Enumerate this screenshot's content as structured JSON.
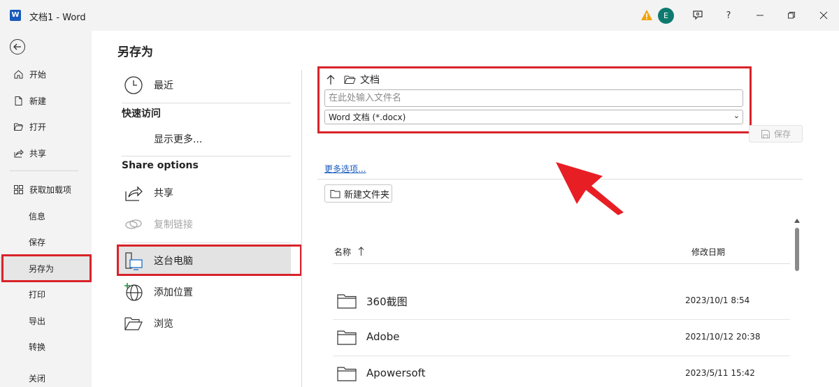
{
  "window": {
    "title": "文档1  -  Word",
    "avatar_initial": "E",
    "help_label": "?"
  },
  "leftnav": {
    "items": [
      {
        "label": "开始",
        "icon": "home-icon"
      },
      {
        "label": "新建",
        "icon": "new-doc-icon"
      },
      {
        "label": "打开",
        "icon": "open-folder-icon"
      },
      {
        "label": "共享",
        "icon": "share-icon"
      },
      {
        "label": "获取加载项",
        "icon": "addins-icon"
      },
      {
        "label": "信息"
      },
      {
        "label": "保存"
      },
      {
        "label": "另存为",
        "selected": true
      },
      {
        "label": "打印"
      },
      {
        "label": "导出"
      },
      {
        "label": "转换"
      },
      {
        "label": "关闭"
      }
    ]
  },
  "saveas": {
    "heading": "另存为",
    "recent_label": "最近",
    "quick_access_label": "快速访问",
    "show_more_label": "显示更多...",
    "share_options_label": "Share options",
    "share_label": "共享",
    "copy_link_label": "复制链接",
    "this_pc_label": "这台电脑",
    "add_location_label": "添加位置",
    "browse_label": "浏览"
  },
  "location": {
    "current_folder": "文档",
    "filename_placeholder": "在此处输入文件名",
    "filetype": "Word 文档 (*.docx)",
    "save_label": "保存",
    "more_options_label": "更多选项...",
    "new_folder_label": "新建文件夹"
  },
  "files": {
    "col_name": "名称",
    "col_date": "修改日期",
    "rows": [
      {
        "name": "360截图",
        "date": "2023/10/1 8:54"
      },
      {
        "name": "Adobe",
        "date": "2021/10/12 20:38"
      },
      {
        "name": "Apowersoft",
        "date": "2023/5/11 15:42"
      }
    ]
  },
  "colors": {
    "accent": "#185abd",
    "highlight": "#d8232a",
    "avatar": "#0e7a6f"
  }
}
